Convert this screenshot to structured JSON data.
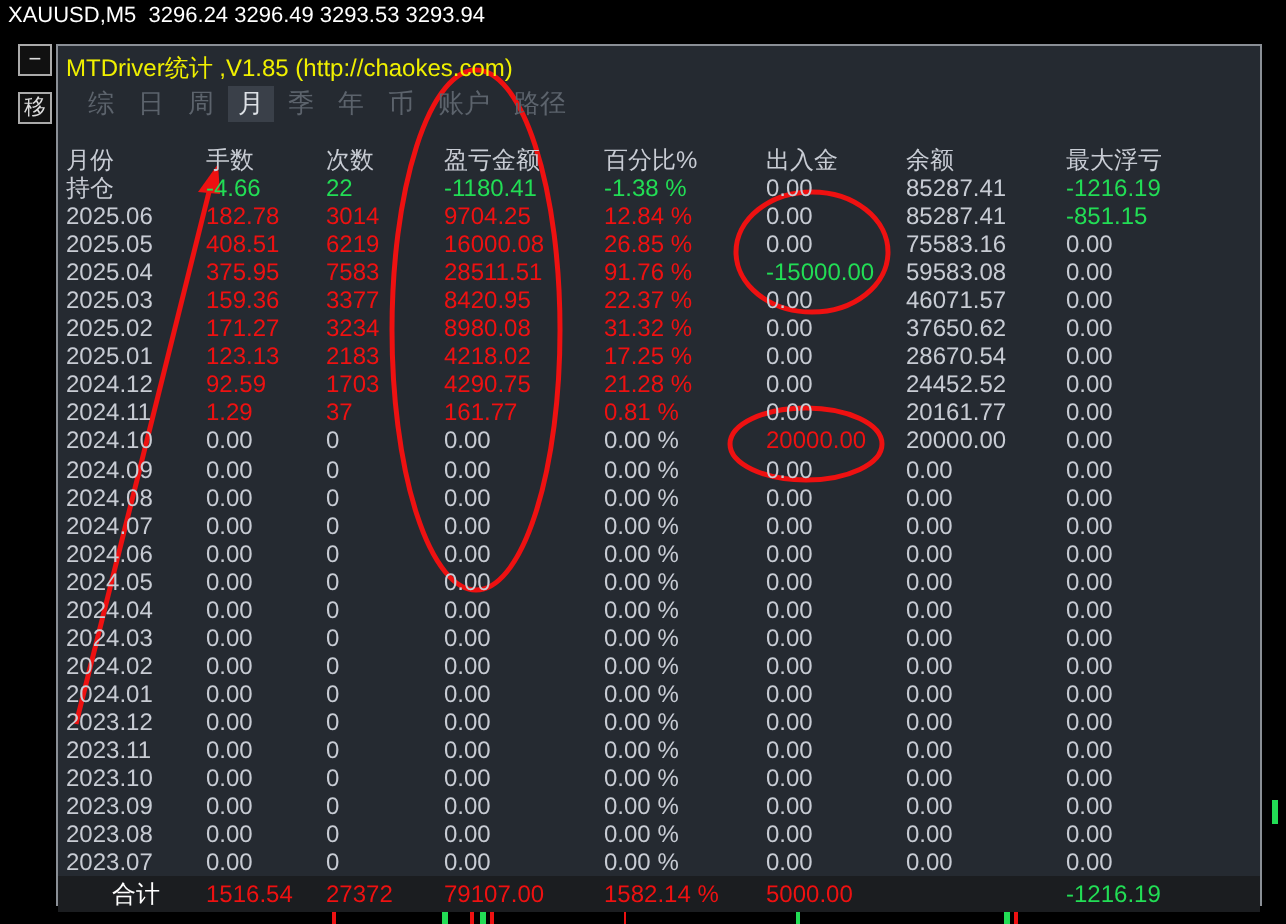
{
  "chart_header": "XAUUSD,M5  3296.24 3296.49 3293.53 3293.94",
  "side_buttons": [
    "−",
    "移"
  ],
  "panel": {
    "title": "MTDriver统计 ,V1.85 (http://chaokes.com)",
    "tabs": [
      {
        "label": "综",
        "selected": false
      },
      {
        "label": "日",
        "selected": false
      },
      {
        "label": "周",
        "selected": false
      },
      {
        "label": "月",
        "selected": true
      },
      {
        "label": "季",
        "selected": false
      },
      {
        "label": "年",
        "selected": false
      },
      {
        "label": "币",
        "selected": false
      },
      {
        "label": "账户",
        "selected": false
      },
      {
        "label": "路径",
        "selected": false
      }
    ],
    "columns": [
      "月份",
      "手数",
      "次数",
      "盈亏金额",
      "百分比%",
      "出入金",
      "余额",
      "最大浮亏"
    ],
    "rows": [
      [
        {
          "text": "持仓",
          "color": "#c8ccd4"
        },
        {
          "text": "-4.66",
          "color": "#22dd55"
        },
        {
          "text": "22",
          "color": "#22dd55"
        },
        {
          "text": "-1180.41",
          "color": "#22dd55"
        },
        {
          "text": "-1.38 %",
          "color": "#22dd55"
        },
        {
          "text": "0.00",
          "color": "#c8ccd4"
        },
        {
          "text": "85287.41",
          "color": "#c8ccd4"
        },
        {
          "text": "-1216.19",
          "color": "#22dd55"
        }
      ],
      [
        {
          "text": "2025.06",
          "color": "#c8ccd4"
        },
        {
          "text": "182.78",
          "color": "#ee1111"
        },
        {
          "text": "3014",
          "color": "#ee1111"
        },
        {
          "text": "9704.25",
          "color": "#ee1111"
        },
        {
          "text": "12.84 %",
          "color": "#ee1111"
        },
        {
          "text": "0.00",
          "color": "#c8ccd4"
        },
        {
          "text": "85287.41",
          "color": "#c8ccd4"
        },
        {
          "text": "-851.15",
          "color": "#22dd55"
        }
      ],
      [
        {
          "text": "2025.05",
          "color": "#c8ccd4"
        },
        {
          "text": "408.51",
          "color": "#ee1111"
        },
        {
          "text": "6219",
          "color": "#ee1111"
        },
        {
          "text": "16000.08",
          "color": "#ee1111"
        },
        {
          "text": "26.85 %",
          "color": "#ee1111"
        },
        {
          "text": "0.00",
          "color": "#c8ccd4"
        },
        {
          "text": "75583.16",
          "color": "#c8ccd4"
        },
        {
          "text": "0.00",
          "color": "#c8ccd4"
        }
      ],
      [
        {
          "text": "2025.04",
          "color": "#c8ccd4"
        },
        {
          "text": "375.95",
          "color": "#ee1111"
        },
        {
          "text": "7583",
          "color": "#ee1111"
        },
        {
          "text": "28511.51",
          "color": "#ee1111"
        },
        {
          "text": "91.76 %",
          "color": "#ee1111"
        },
        {
          "text": "-15000.00",
          "color": "#22dd55"
        },
        {
          "text": "59583.08",
          "color": "#c8ccd4"
        },
        {
          "text": "0.00",
          "color": "#c8ccd4"
        }
      ],
      [
        {
          "text": "2025.03",
          "color": "#c8ccd4"
        },
        {
          "text": "159.36",
          "color": "#ee1111"
        },
        {
          "text": "3377",
          "color": "#ee1111"
        },
        {
          "text": "8420.95",
          "color": "#ee1111"
        },
        {
          "text": "22.37 %",
          "color": "#ee1111"
        },
        {
          "text": "0.00",
          "color": "#c8ccd4"
        },
        {
          "text": "46071.57",
          "color": "#c8ccd4"
        },
        {
          "text": "0.00",
          "color": "#c8ccd4"
        }
      ],
      [
        {
          "text": "2025.02",
          "color": "#c8ccd4"
        },
        {
          "text": "171.27",
          "color": "#ee1111"
        },
        {
          "text": "3234",
          "color": "#ee1111"
        },
        {
          "text": "8980.08",
          "color": "#ee1111"
        },
        {
          "text": "31.32 %",
          "color": "#ee1111"
        },
        {
          "text": "0.00",
          "color": "#c8ccd4"
        },
        {
          "text": "37650.62",
          "color": "#c8ccd4"
        },
        {
          "text": "0.00",
          "color": "#c8ccd4"
        }
      ],
      [
        {
          "text": "2025.01",
          "color": "#c8ccd4"
        },
        {
          "text": "123.13",
          "color": "#ee1111"
        },
        {
          "text": "2183",
          "color": "#ee1111"
        },
        {
          "text": "4218.02",
          "color": "#ee1111"
        },
        {
          "text": "17.25 %",
          "color": "#ee1111"
        },
        {
          "text": "0.00",
          "color": "#c8ccd4"
        },
        {
          "text": "28670.54",
          "color": "#c8ccd4"
        },
        {
          "text": "0.00",
          "color": "#c8ccd4"
        }
      ],
      [
        {
          "text": "2024.12",
          "color": "#c8ccd4"
        },
        {
          "text": "92.59",
          "color": "#ee1111"
        },
        {
          "text": "1703",
          "color": "#ee1111"
        },
        {
          "text": "4290.75",
          "color": "#ee1111"
        },
        {
          "text": "21.28 %",
          "color": "#ee1111"
        },
        {
          "text": "0.00",
          "color": "#c8ccd4"
        },
        {
          "text": "24452.52",
          "color": "#c8ccd4"
        },
        {
          "text": "0.00",
          "color": "#c8ccd4"
        }
      ],
      [
        {
          "text": "2024.11",
          "color": "#c8ccd4"
        },
        {
          "text": "1.29",
          "color": "#ee1111"
        },
        {
          "text": "37",
          "color": "#ee1111"
        },
        {
          "text": "161.77",
          "color": "#ee1111"
        },
        {
          "text": "0.81 %",
          "color": "#ee1111"
        },
        {
          "text": "0.00",
          "color": "#c8ccd4"
        },
        {
          "text": "20161.77",
          "color": "#c8ccd4"
        },
        {
          "text": "0.00",
          "color": "#c8ccd4"
        }
      ],
      [
        {
          "text": "2024.10",
          "color": "#c8ccd4"
        },
        {
          "text": "0.00",
          "color": "#c8ccd4"
        },
        {
          "text": "0",
          "color": "#c8ccd4"
        },
        {
          "text": "0.00",
          "color": "#c8ccd4"
        },
        {
          "text": "0.00 %",
          "color": "#c8ccd4"
        },
        {
          "text": "20000.00",
          "color": "#ee1111"
        },
        {
          "text": "20000.00",
          "color": "#c8ccd4"
        },
        {
          "text": "0.00",
          "color": "#c8ccd4"
        }
      ],
      [
        {
          "text": "2024.09",
          "color": "#c8ccd4"
        },
        {
          "text": "0.00",
          "color": "#c8ccd4"
        },
        {
          "text": "0",
          "color": "#c8ccd4"
        },
        {
          "text": "0.00",
          "color": "#c8ccd4"
        },
        {
          "text": "0.00 %",
          "color": "#c8ccd4"
        },
        {
          "text": "0.00",
          "color": "#c8ccd4"
        },
        {
          "text": "0.00",
          "color": "#c8ccd4"
        },
        {
          "text": "0.00",
          "color": "#c8ccd4"
        }
      ],
      [
        {
          "text": "2024.08",
          "color": "#c8ccd4"
        },
        {
          "text": "0.00",
          "color": "#c8ccd4"
        },
        {
          "text": "0",
          "color": "#c8ccd4"
        },
        {
          "text": "0.00",
          "color": "#c8ccd4"
        },
        {
          "text": "0.00 %",
          "color": "#c8ccd4"
        },
        {
          "text": "0.00",
          "color": "#c8ccd4"
        },
        {
          "text": "0.00",
          "color": "#c8ccd4"
        },
        {
          "text": "0.00",
          "color": "#c8ccd4"
        }
      ],
      [
        {
          "text": "2024.07",
          "color": "#c8ccd4"
        },
        {
          "text": "0.00",
          "color": "#c8ccd4"
        },
        {
          "text": "0",
          "color": "#c8ccd4"
        },
        {
          "text": "0.00",
          "color": "#c8ccd4"
        },
        {
          "text": "0.00 %",
          "color": "#c8ccd4"
        },
        {
          "text": "0.00",
          "color": "#c8ccd4"
        },
        {
          "text": "0.00",
          "color": "#c8ccd4"
        },
        {
          "text": "0.00",
          "color": "#c8ccd4"
        }
      ],
      [
        {
          "text": "2024.06",
          "color": "#c8ccd4"
        },
        {
          "text": "0.00",
          "color": "#c8ccd4"
        },
        {
          "text": "0",
          "color": "#c8ccd4"
        },
        {
          "text": "0.00",
          "color": "#c8ccd4"
        },
        {
          "text": "0.00 %",
          "color": "#c8ccd4"
        },
        {
          "text": "0.00",
          "color": "#c8ccd4"
        },
        {
          "text": "0.00",
          "color": "#c8ccd4"
        },
        {
          "text": "0.00",
          "color": "#c8ccd4"
        }
      ],
      [
        {
          "text": "2024.05",
          "color": "#c8ccd4"
        },
        {
          "text": "0.00",
          "color": "#c8ccd4"
        },
        {
          "text": "0",
          "color": "#c8ccd4"
        },
        {
          "text": "0.00",
          "color": "#c8ccd4"
        },
        {
          "text": "0.00 %",
          "color": "#c8ccd4"
        },
        {
          "text": "0.00",
          "color": "#c8ccd4"
        },
        {
          "text": "0.00",
          "color": "#c8ccd4"
        },
        {
          "text": "0.00",
          "color": "#c8ccd4"
        }
      ],
      [
        {
          "text": "2024.04",
          "color": "#c8ccd4"
        },
        {
          "text": "0.00",
          "color": "#c8ccd4"
        },
        {
          "text": "0",
          "color": "#c8ccd4"
        },
        {
          "text": "0.00",
          "color": "#c8ccd4"
        },
        {
          "text": "0.00 %",
          "color": "#c8ccd4"
        },
        {
          "text": "0.00",
          "color": "#c8ccd4"
        },
        {
          "text": "0.00",
          "color": "#c8ccd4"
        },
        {
          "text": "0.00",
          "color": "#c8ccd4"
        }
      ],
      [
        {
          "text": "2024.03",
          "color": "#c8ccd4"
        },
        {
          "text": "0.00",
          "color": "#c8ccd4"
        },
        {
          "text": "0",
          "color": "#c8ccd4"
        },
        {
          "text": "0.00",
          "color": "#c8ccd4"
        },
        {
          "text": "0.00 %",
          "color": "#c8ccd4"
        },
        {
          "text": "0.00",
          "color": "#c8ccd4"
        },
        {
          "text": "0.00",
          "color": "#c8ccd4"
        },
        {
          "text": "0.00",
          "color": "#c8ccd4"
        }
      ],
      [
        {
          "text": "2024.02",
          "color": "#c8ccd4"
        },
        {
          "text": "0.00",
          "color": "#c8ccd4"
        },
        {
          "text": "0",
          "color": "#c8ccd4"
        },
        {
          "text": "0.00",
          "color": "#c8ccd4"
        },
        {
          "text": "0.00 %",
          "color": "#c8ccd4"
        },
        {
          "text": "0.00",
          "color": "#c8ccd4"
        },
        {
          "text": "0.00",
          "color": "#c8ccd4"
        },
        {
          "text": "0.00",
          "color": "#c8ccd4"
        }
      ],
      [
        {
          "text": "2024.01",
          "color": "#c8ccd4"
        },
        {
          "text": "0.00",
          "color": "#c8ccd4"
        },
        {
          "text": "0",
          "color": "#c8ccd4"
        },
        {
          "text": "0.00",
          "color": "#c8ccd4"
        },
        {
          "text": "0.00 %",
          "color": "#c8ccd4"
        },
        {
          "text": "0.00",
          "color": "#c8ccd4"
        },
        {
          "text": "0.00",
          "color": "#c8ccd4"
        },
        {
          "text": "0.00",
          "color": "#c8ccd4"
        }
      ],
      [
        {
          "text": "2023.12",
          "color": "#c8ccd4"
        },
        {
          "text": "0.00",
          "color": "#c8ccd4"
        },
        {
          "text": "0",
          "color": "#c8ccd4"
        },
        {
          "text": "0.00",
          "color": "#c8ccd4"
        },
        {
          "text": "0.00 %",
          "color": "#c8ccd4"
        },
        {
          "text": "0.00",
          "color": "#c8ccd4"
        },
        {
          "text": "0.00",
          "color": "#c8ccd4"
        },
        {
          "text": "0.00",
          "color": "#c8ccd4"
        }
      ],
      [
        {
          "text": "2023.11",
          "color": "#c8ccd4"
        },
        {
          "text": "0.00",
          "color": "#c8ccd4"
        },
        {
          "text": "0",
          "color": "#c8ccd4"
        },
        {
          "text": "0.00",
          "color": "#c8ccd4"
        },
        {
          "text": "0.00 %",
          "color": "#c8ccd4"
        },
        {
          "text": "0.00",
          "color": "#c8ccd4"
        },
        {
          "text": "0.00",
          "color": "#c8ccd4"
        },
        {
          "text": "0.00",
          "color": "#c8ccd4"
        }
      ],
      [
        {
          "text": "2023.10",
          "color": "#c8ccd4"
        },
        {
          "text": "0.00",
          "color": "#c8ccd4"
        },
        {
          "text": "0",
          "color": "#c8ccd4"
        },
        {
          "text": "0.00",
          "color": "#c8ccd4"
        },
        {
          "text": "0.00 %",
          "color": "#c8ccd4"
        },
        {
          "text": "0.00",
          "color": "#c8ccd4"
        },
        {
          "text": "0.00",
          "color": "#c8ccd4"
        },
        {
          "text": "0.00",
          "color": "#c8ccd4"
        }
      ],
      [
        {
          "text": "2023.09",
          "color": "#c8ccd4"
        },
        {
          "text": "0.00",
          "color": "#c8ccd4"
        },
        {
          "text": "0",
          "color": "#c8ccd4"
        },
        {
          "text": "0.00",
          "color": "#c8ccd4"
        },
        {
          "text": "0.00 %",
          "color": "#c8ccd4"
        },
        {
          "text": "0.00",
          "color": "#c8ccd4"
        },
        {
          "text": "0.00",
          "color": "#c8ccd4"
        },
        {
          "text": "0.00",
          "color": "#c8ccd4"
        }
      ],
      [
        {
          "text": "2023.08",
          "color": "#c8ccd4"
        },
        {
          "text": "0.00",
          "color": "#c8ccd4"
        },
        {
          "text": "0",
          "color": "#c8ccd4"
        },
        {
          "text": "0.00",
          "color": "#c8ccd4"
        },
        {
          "text": "0.00 %",
          "color": "#c8ccd4"
        },
        {
          "text": "0.00",
          "color": "#c8ccd4"
        },
        {
          "text": "0.00",
          "color": "#c8ccd4"
        },
        {
          "text": "0.00",
          "color": "#c8ccd4"
        }
      ],
      [
        {
          "text": "2023.07",
          "color": "#c8ccd4"
        },
        {
          "text": "0.00",
          "color": "#c8ccd4"
        },
        {
          "text": "0",
          "color": "#c8ccd4"
        },
        {
          "text": "0.00",
          "color": "#c8ccd4"
        },
        {
          "text": "0.00 %",
          "color": "#c8ccd4"
        },
        {
          "text": "0.00",
          "color": "#c8ccd4"
        },
        {
          "text": "0.00",
          "color": "#c8ccd4"
        },
        {
          "text": "0.00",
          "color": "#c8ccd4"
        }
      ]
    ],
    "footer": {
      "label": {
        "text": "合计",
        "color": "#ffffff"
      },
      "lots": {
        "text": "1516.54",
        "color": "#ee1111"
      },
      "trades": {
        "text": "27372",
        "color": "#ee1111"
      },
      "profit": {
        "text": "79107.00",
        "color": "#ee1111"
      },
      "percent": {
        "text": "1582.14 %",
        "color": "#ee1111"
      },
      "deposit": {
        "text": "5000.00",
        "color": "#ee1111"
      },
      "max_drawdown": {
        "text": "-1216.19",
        "color": "#22dd55"
      }
    }
  }
}
